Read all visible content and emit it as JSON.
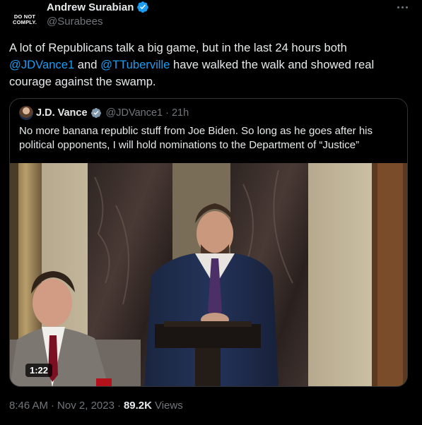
{
  "author": {
    "avatar_text_line1": "DO NOT",
    "avatar_text_line2": "COMPLY.",
    "name": "Andrew Surabian",
    "handle": "@Surabees"
  },
  "tweet": {
    "text_part1": "A lot of Republicans talk a big game, but in the last 24 hours both ",
    "mention1": "@JDVance1",
    "text_part2": " and ",
    "mention2": "@TTuberville",
    "text_part3": " have walked the walk and showed real courage against the swamp."
  },
  "quote": {
    "name": "J.D. Vance",
    "handle": "@JDVance1",
    "separator": "·",
    "time": "21h",
    "text": "No more banana republic stuff from Joe Biden. So long as he goes after his political opponents, I will hold nominations to the Department of “Justice”",
    "video_duration": "1:22"
  },
  "footer": {
    "time": "8:46 AM",
    "separator": "·",
    "date": "Nov 2, 2023",
    "separator2": "·",
    "views_count": "89.2K",
    "views_label": "Views"
  },
  "colors": {
    "background": "#000000",
    "text": "#e7e9ea",
    "secondary": "#71767b",
    "link": "#1d9bf0",
    "border": "#2f3336"
  }
}
